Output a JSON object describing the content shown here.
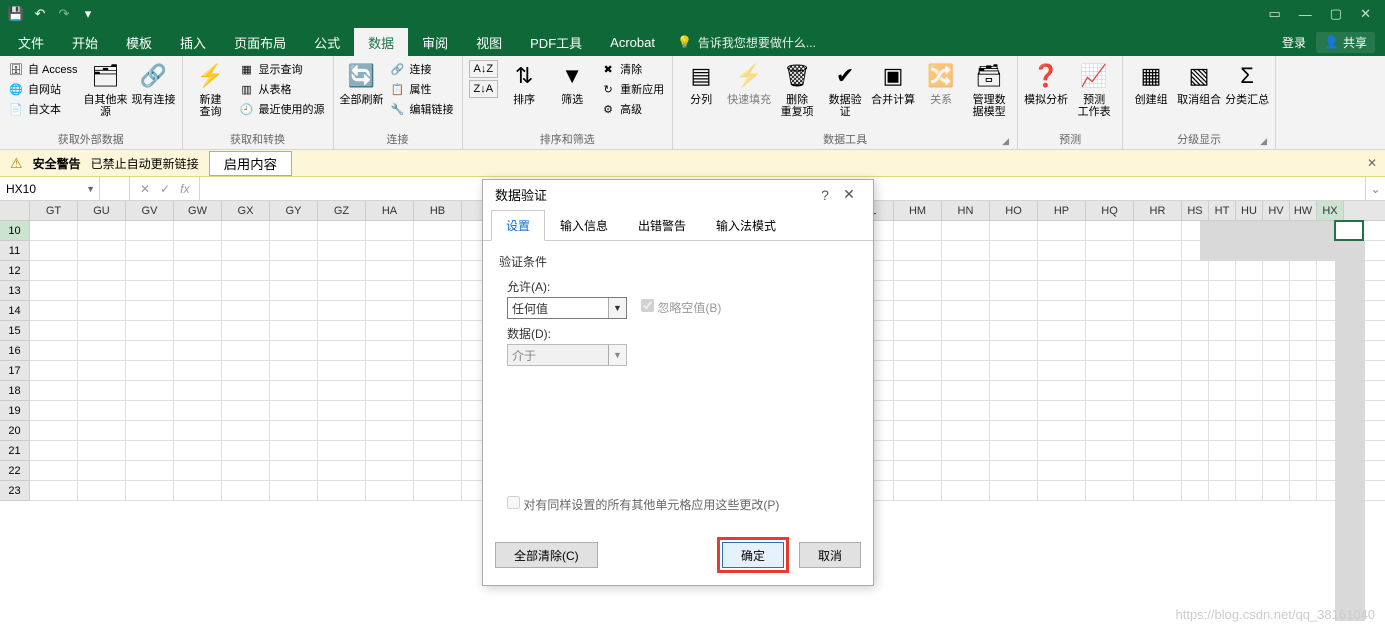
{
  "qat": {
    "save": "💾",
    "undo": "↶",
    "redo": "↷"
  },
  "win": {
    "ribbonOpts": "▭",
    "min": "—",
    "max": "▢",
    "close": "✕"
  },
  "menu": {
    "file": "文件",
    "home": "开始",
    "template": "模板",
    "insert": "插入",
    "layout": "页面布局",
    "formula": "公式",
    "data": "数据",
    "review": "审阅",
    "view": "视图",
    "pdf": "PDF工具",
    "acrobat": "Acrobat",
    "tellme": "告诉我您想要做什么...",
    "login": "登录",
    "share": "共享"
  },
  "ribbon": {
    "ext": {
      "access": "自 Access",
      "web": "自网站",
      "text": "自文本",
      "other": "自其他来源",
      "existing": "现有连接",
      "label": "获取外部数据"
    },
    "query": {
      "new": "新建\n查询",
      "show": "显示查询",
      "table": "从表格",
      "recent": "最近使用的源",
      "label": "获取和转换"
    },
    "conn": {
      "refresh": "全部刷新",
      "connections": "连接",
      "properties": "属性",
      "editlinks": "编辑链接",
      "label": "连接"
    },
    "sort": {
      "az": "A↓Z",
      "za": "Z↓A",
      "sort": "排序",
      "filter": "筛选",
      "clear": "清除",
      "reapply": "重新应用",
      "advanced": "高级",
      "label": "排序和筛选"
    },
    "tools": {
      "t2c": "分列",
      "flash": "快速填充",
      "dup": "删除\n重复项",
      "valid": "数据验\n证",
      "consolidate": "合并计算",
      "rel": "关系",
      "model": "管理数\n据模型",
      "label": "数据工具"
    },
    "forecast": {
      "whatif": "模拟分析",
      "sheet": "预测\n工作表",
      "label": "预测"
    },
    "outline": {
      "group": "创建组",
      "ungroup": "取消组合",
      "subtotal": "分类汇总",
      "label": "分级显示"
    }
  },
  "sec": {
    "title": "安全警告",
    "msg": "已禁止自动更新链接",
    "enable": "启用内容"
  },
  "namebox": "HX10",
  "cols_wide": [
    "GT",
    "GU",
    "GV",
    "GW",
    "GX",
    "GY",
    "GZ",
    "HA",
    "HB",
    "",
    "",
    "",
    "",
    "",
    "",
    "",
    "",
    "HL",
    "HM",
    "HN",
    "HO",
    "HP",
    "HQ",
    "HR"
  ],
  "cols_narrow": [
    "HS",
    "HT",
    "HU",
    "HV",
    "HW",
    "HX"
  ],
  "rows": [
    "10",
    "11",
    "12",
    "13",
    "14",
    "15",
    "16",
    "17",
    "18",
    "19",
    "20",
    "21",
    "22",
    "23"
  ],
  "dialog": {
    "title": "数据验证",
    "tabs": {
      "settings": "设置",
      "input": "输入信息",
      "error": "出错警告",
      "ime": "输入法模式"
    },
    "criteria": "验证条件",
    "allow": "允许(A):",
    "allow_val": "任何值",
    "ignore": "忽略空值(B)",
    "data": "数据(D):",
    "data_val": "介于",
    "apply": "对有同样设置的所有其他单元格应用这些更改(P)",
    "clearall": "全部清除(C)",
    "ok": "确定",
    "cancel": "取消"
  },
  "watermark": "https://blog.csdn.net/qq_38161040"
}
